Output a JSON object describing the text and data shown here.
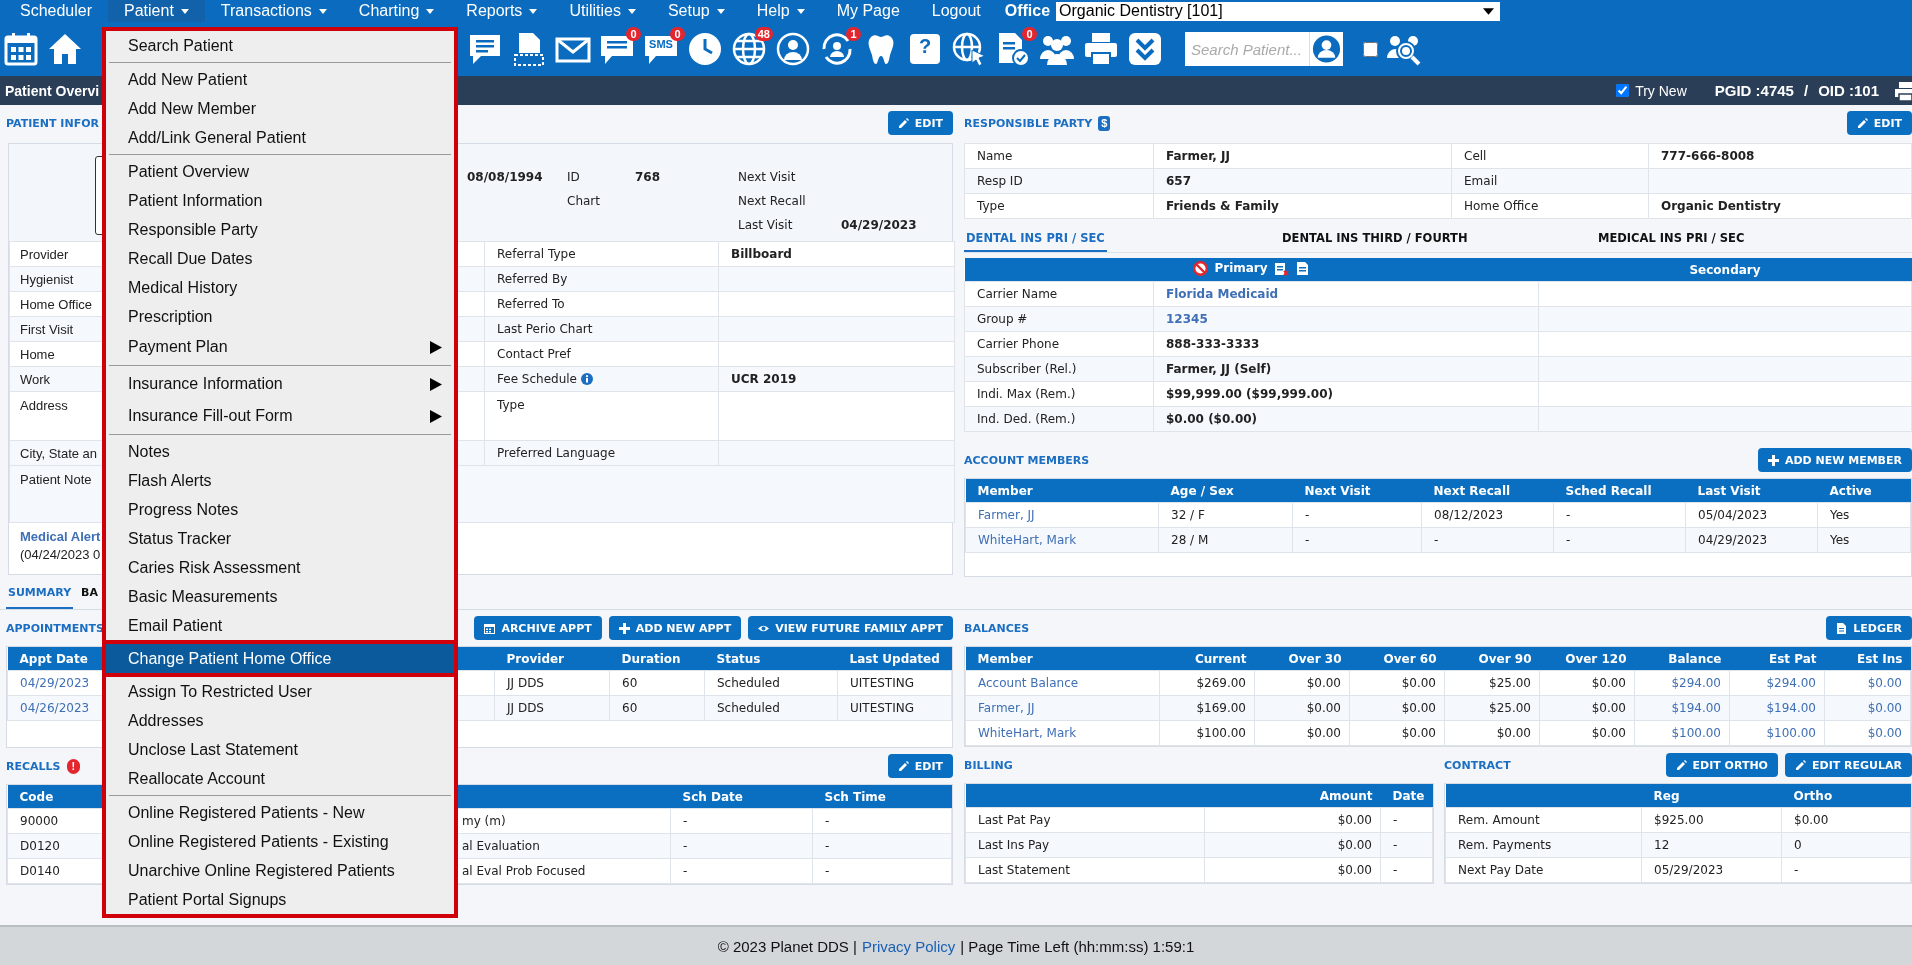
{
  "nav": {
    "items": [
      {
        "label": "Scheduler",
        "dropdown": false,
        "selected": false
      },
      {
        "label": "Patient",
        "dropdown": true,
        "selected": true
      },
      {
        "label": "Transactions",
        "dropdown": true,
        "selected": false
      },
      {
        "label": "Charting",
        "dropdown": true,
        "selected": false
      },
      {
        "label": "Reports",
        "dropdown": true,
        "selected": false
      },
      {
        "label": "Utilities",
        "dropdown": true,
        "selected": false
      },
      {
        "label": "Setup",
        "dropdown": true,
        "selected": false
      },
      {
        "label": "Help",
        "dropdown": true,
        "selected": false
      },
      {
        "label": "My Page",
        "dropdown": false,
        "selected": false
      },
      {
        "label": "Logout",
        "dropdown": false,
        "selected": false
      }
    ],
    "office_label": "Office",
    "office_value": "Organic Dentistry [101]"
  },
  "toolbar": {
    "items": [
      {
        "kind": "calendar"
      },
      {
        "kind": "home"
      },
      {
        "kind": "chat-doc"
      },
      {
        "kind": "print-doc"
      },
      {
        "kind": "envelope"
      },
      {
        "kind": "chat",
        "badge": "0"
      },
      {
        "kind": "sms",
        "label": "SMS",
        "badge": "0"
      },
      {
        "kind": "clock"
      },
      {
        "kind": "globe",
        "badge": "48"
      },
      {
        "kind": "globe-user"
      },
      {
        "kind": "refresh-user",
        "badge": "1"
      },
      {
        "kind": "tooth"
      },
      {
        "kind": "tooth-help",
        "label": "?"
      },
      {
        "kind": "globe-cursor"
      },
      {
        "kind": "doc-check",
        "badge": "0"
      },
      {
        "kind": "people"
      },
      {
        "kind": "printer"
      },
      {
        "kind": "chevrons"
      }
    ],
    "search": {
      "placeholder": "Search Patient..."
    },
    "checkbox": {
      "checked": false
    }
  },
  "subbar": {
    "title": "Patient Overvi",
    "try_new": {
      "label": "Try New",
      "checked": true
    },
    "pgid": "PGID :4745",
    "separator": "/",
    "oid": "OID :101"
  },
  "menu": {
    "groups": [
      {
        "items": [
          {
            "label": "Search Patient",
            "submenu": false,
            "selected": false
          }
        ]
      },
      {
        "items": [
          {
            "label": "Add New Patient",
            "submenu": false,
            "selected": false
          },
          {
            "label": "Add New Member",
            "submenu": false,
            "selected": false
          },
          {
            "label": "Add/Link General Patient",
            "submenu": false,
            "selected": false
          }
        ]
      },
      {
        "items": [
          {
            "label": "Patient Overview",
            "submenu": false,
            "selected": false
          },
          {
            "label": "Patient Information",
            "submenu": false,
            "selected": false
          },
          {
            "label": "Responsible Party",
            "submenu": false,
            "selected": false
          },
          {
            "label": "Recall Due Dates",
            "submenu": false,
            "selected": false
          },
          {
            "label": "Medical History",
            "submenu": false,
            "selected": false
          },
          {
            "label": "Prescription",
            "submenu": false,
            "selected": false
          },
          {
            "label": "Payment Plan",
            "submenu": true,
            "selected": false
          }
        ]
      },
      {
        "items": [
          {
            "label": "Insurance Information",
            "submenu": true,
            "selected": false
          },
          {
            "label": "Insurance Fill-out Form",
            "submenu": true,
            "selected": false
          }
        ]
      },
      {
        "items": [
          {
            "label": "Notes",
            "submenu": false,
            "selected": false
          },
          {
            "label": "Flash Alerts",
            "submenu": false,
            "selected": false
          },
          {
            "label": "Progress Notes",
            "submenu": false,
            "selected": false
          },
          {
            "label": "Status Tracker",
            "submenu": false,
            "selected": false
          },
          {
            "label": "Caries Risk Assessment",
            "submenu": false,
            "selected": false
          },
          {
            "label": "Basic Measurements",
            "submenu": false,
            "selected": false
          },
          {
            "label": "Email Patient",
            "submenu": false,
            "selected": false
          },
          {
            "label": "Change Patient Home Office",
            "submenu": false,
            "selected": true
          },
          {
            "label": "Assign To Restricted User",
            "submenu": false,
            "selected": false
          },
          {
            "label": "Addresses",
            "submenu": false,
            "selected": false
          },
          {
            "label": "Unclose Last Statement",
            "submenu": false,
            "selected": false
          },
          {
            "label": "Reallocate Account",
            "submenu": false,
            "selected": false
          }
        ]
      },
      {
        "items": [
          {
            "label": "Online Registered Patients - New",
            "submenu": false,
            "selected": false
          },
          {
            "label": "Online Registered Patients - Existing",
            "submenu": false,
            "selected": false
          },
          {
            "label": "Unarchive Online Registered Patients",
            "submenu": false,
            "selected": false
          },
          {
            "label": "Patient Portal Signups",
            "submenu": false,
            "selected": false
          }
        ]
      }
    ]
  },
  "patient_info": {
    "title": "PATIENT INFOR",
    "edit_button": "EDIT",
    "summary": [
      [
        {
          "value": "08/08/1994"
        }
      ],
      [
        {
          "label": "ID",
          "value": "768"
        },
        {
          "label": "Chart"
        }
      ],
      [
        {
          "label": "Next Visit"
        },
        {
          "label": "Next Recall"
        },
        {
          "label": "Last Visit",
          "value": "04/29/2023"
        }
      ]
    ],
    "details": [
      {
        "kind": "line",
        "label": "Provider",
        "right_label": "Referral Type",
        "info": false,
        "right_value": "Billboard"
      },
      {
        "kind": "line",
        "label": "Hygienist",
        "right_label": "Referred By",
        "info": false
      },
      {
        "kind": "line",
        "label": "Home Office",
        "right_label": "Referred To",
        "info": false
      },
      {
        "kind": "line",
        "label": "First Visit",
        "right_label": "Last Perio Chart",
        "info": false
      },
      {
        "kind": "line",
        "label": "Home",
        "right_label": "Contact Pref",
        "info": false
      },
      {
        "kind": "line",
        "label": "Work",
        "right_label": "Fee Schedule",
        "info": true,
        "right_value": "UCR 2019"
      },
      {
        "kind": "area",
        "label": "Address",
        "right_label": "Type",
        "info": false
      },
      {
        "kind": "line",
        "label": "City, State an",
        "right_label": "Preferred Language",
        "info": false
      },
      {
        "kind": "note",
        "label": "Patient Note"
      }
    ],
    "medical_alerts": {
      "title": "Medical Alert",
      "text": "(04/24/2023 0"
    }
  },
  "responsible_party": {
    "title": "RESPONSIBLE PARTY",
    "badge": "$",
    "edit_button": "EDIT",
    "rows": [
      [
        "Name",
        "Farmer, JJ",
        "Cell",
        "777-666-8008"
      ],
      [
        "Resp ID",
        "657",
        "Email"
      ],
      [
        "Type",
        "Friends & Family",
        "Home Office",
        "Organic Dentistry"
      ]
    ]
  },
  "insurance": {
    "tabs": [
      {
        "label": "DENTAL INS PRI / SEC",
        "selected": true
      },
      {
        "label": "DENTAL INS THIRD / FOURTH",
        "selected": false
      },
      {
        "label": "MEDICAL INS PRI / SEC",
        "selected": false
      }
    ],
    "primary": "Primary",
    "secondary": "Secondary",
    "rows": [
      {
        "label": "Carrier Name",
        "value": "Florida Medicaid",
        "link": true
      },
      {
        "label": "Group #",
        "value": "12345",
        "link": true
      },
      {
        "label": "Carrier Phone",
        "value": "888-333-3333",
        "link": false
      },
      {
        "label": "Subscriber (Rel.)",
        "value": "Farmer, JJ (Self)",
        "link": false
      },
      {
        "label": "Indi. Max (Rem.)",
        "value": "$99,999.00 ($99,999.00)",
        "link": false
      },
      {
        "label": "Ind. Ded. (Rem.)",
        "value": "$0.00 ($0.00)",
        "link": false
      }
    ]
  },
  "account_members": {
    "title": "ACCOUNT MEMBERS",
    "add_button": "ADD NEW MEMBER",
    "columns": [
      {
        "label": "Member",
        "link": true
      },
      {
        "label": "Age / Sex",
        "link": false
      },
      {
        "label": "Next Visit",
        "link": false
      },
      {
        "label": "Next Recall",
        "link": false
      },
      {
        "label": "Sched Recall",
        "link": false
      },
      {
        "label": "Last Visit",
        "link": false
      },
      {
        "label": "Active",
        "link": false
      }
    ],
    "rows": [
      [
        "Farmer, JJ",
        "32 / F",
        "-",
        "08/12/2023",
        "-",
        "05/04/2023",
        "Yes"
      ],
      [
        "WhiteHart, Mark",
        "28 / M",
        "-",
        "-",
        "-",
        "04/29/2023",
        "Yes"
      ]
    ]
  },
  "tabs": [
    {
      "label": "SUMMARY",
      "selected": true
    },
    {
      "label": "BA",
      "selected": false
    }
  ],
  "appointments": {
    "title": "APPOINTMENTS",
    "buttons": [
      "ARCHIVE APPT",
      "ADD NEW APPT",
      "VIEW FUTURE FAMILY APPT"
    ],
    "columns": [
      {
        "label": "Appt Date",
        "link": true
      },
      {
        "label": "Provider",
        "link": false
      },
      {
        "label": "Duration",
        "link": false
      },
      {
        "label": "Status",
        "link": false
      },
      {
        "label": "Last Updated",
        "link": false
      }
    ],
    "rows": [
      [
        "04/29/2023",
        "JJ DDS",
        "60",
        "Scheduled",
        "UITESTING"
      ],
      [
        "04/26/2023",
        "JJ DDS",
        "60",
        "Scheduled",
        "UITESTING"
      ]
    ]
  },
  "recalls": {
    "title": "RECALLS",
    "alert": "!",
    "edit_button": "EDIT",
    "columns": [
      {
        "label": "Code",
        "link": false
      },
      {
        "link": false
      },
      {
        "label": "Sch Date",
        "link": false
      },
      {
        "label": "Sch Time",
        "link": false
      }
    ],
    "rows": [
      [
        "90000",
        "my (m)",
        "-",
        "-"
      ],
      [
        "D0120",
        "al Evaluation",
        "-",
        "-"
      ],
      [
        "D0140",
        "al Eval Prob Focused",
        "-",
        "-"
      ]
    ]
  },
  "balances": {
    "title": "BALANCES",
    "ledger_button": "LEDGER",
    "columns": [
      {
        "label": "Member",
        "link": true
      },
      {
        "label": "Current",
        "link": false
      },
      {
        "label": "Over 30",
        "link": false
      },
      {
        "label": "Over 60",
        "link": false
      },
      {
        "label": "Over 90",
        "link": false
      },
      {
        "label": "Over 120",
        "link": false
      },
      {
        "label": "Balance",
        "link": true
      },
      {
        "label": "Est Pat",
        "link": true
      },
      {
        "label": "Est Ins",
        "link": true
      }
    ],
    "rows": [
      [
        "Account Balance",
        "$269.00",
        "$0.00",
        "$0.00",
        "$25.00",
        "$0.00",
        "$294.00",
        "$294.00",
        "$0.00"
      ],
      [
        "Farmer, JJ",
        "$169.00",
        "$0.00",
        "$0.00",
        "$25.00",
        "$0.00",
        "$194.00",
        "$194.00",
        "$0.00"
      ],
      [
        "WhiteHart, Mark",
        "$100.00",
        "$0.00",
        "$0.00",
        "$0.00",
        "$0.00",
        "$100.00",
        "$100.00",
        "$0.00"
      ]
    ]
  },
  "billing": {
    "title": "BILLING",
    "columns": [
      {
        "link": false
      },
      {
        "label": "Amount",
        "link": false
      },
      {
        "label": "Date",
        "link": false
      }
    ],
    "rows": [
      [
        "Last Pat Pay",
        "$0.00",
        "-"
      ],
      [
        "Last Ins Pay",
        "$0.00",
        "-"
      ],
      [
        "Last Statement",
        "$0.00",
        "-"
      ]
    ]
  },
  "contract": {
    "title": "CONTRACT",
    "buttons": [
      "EDIT ORTHO",
      "EDIT REGULAR"
    ],
    "columns": [
      {
        "link": false
      },
      {
        "label": "Reg",
        "link": false
      },
      {
        "label": "Ortho",
        "link": false
      }
    ],
    "rows": [
      [
        "Rem. Amount",
        "$925.00",
        "$0.00"
      ],
      [
        "Rem. Payments",
        "12",
        "0"
      ],
      [
        "Next Pay Date",
        "05/29/2023",
        "-"
      ]
    ]
  },
  "footer": {
    "copyright": "© 2023 Planet DDS |",
    "link": "Privacy Policy",
    "time_left": "| Page Time Left (hh:mm:ss) 1:59:1"
  }
}
